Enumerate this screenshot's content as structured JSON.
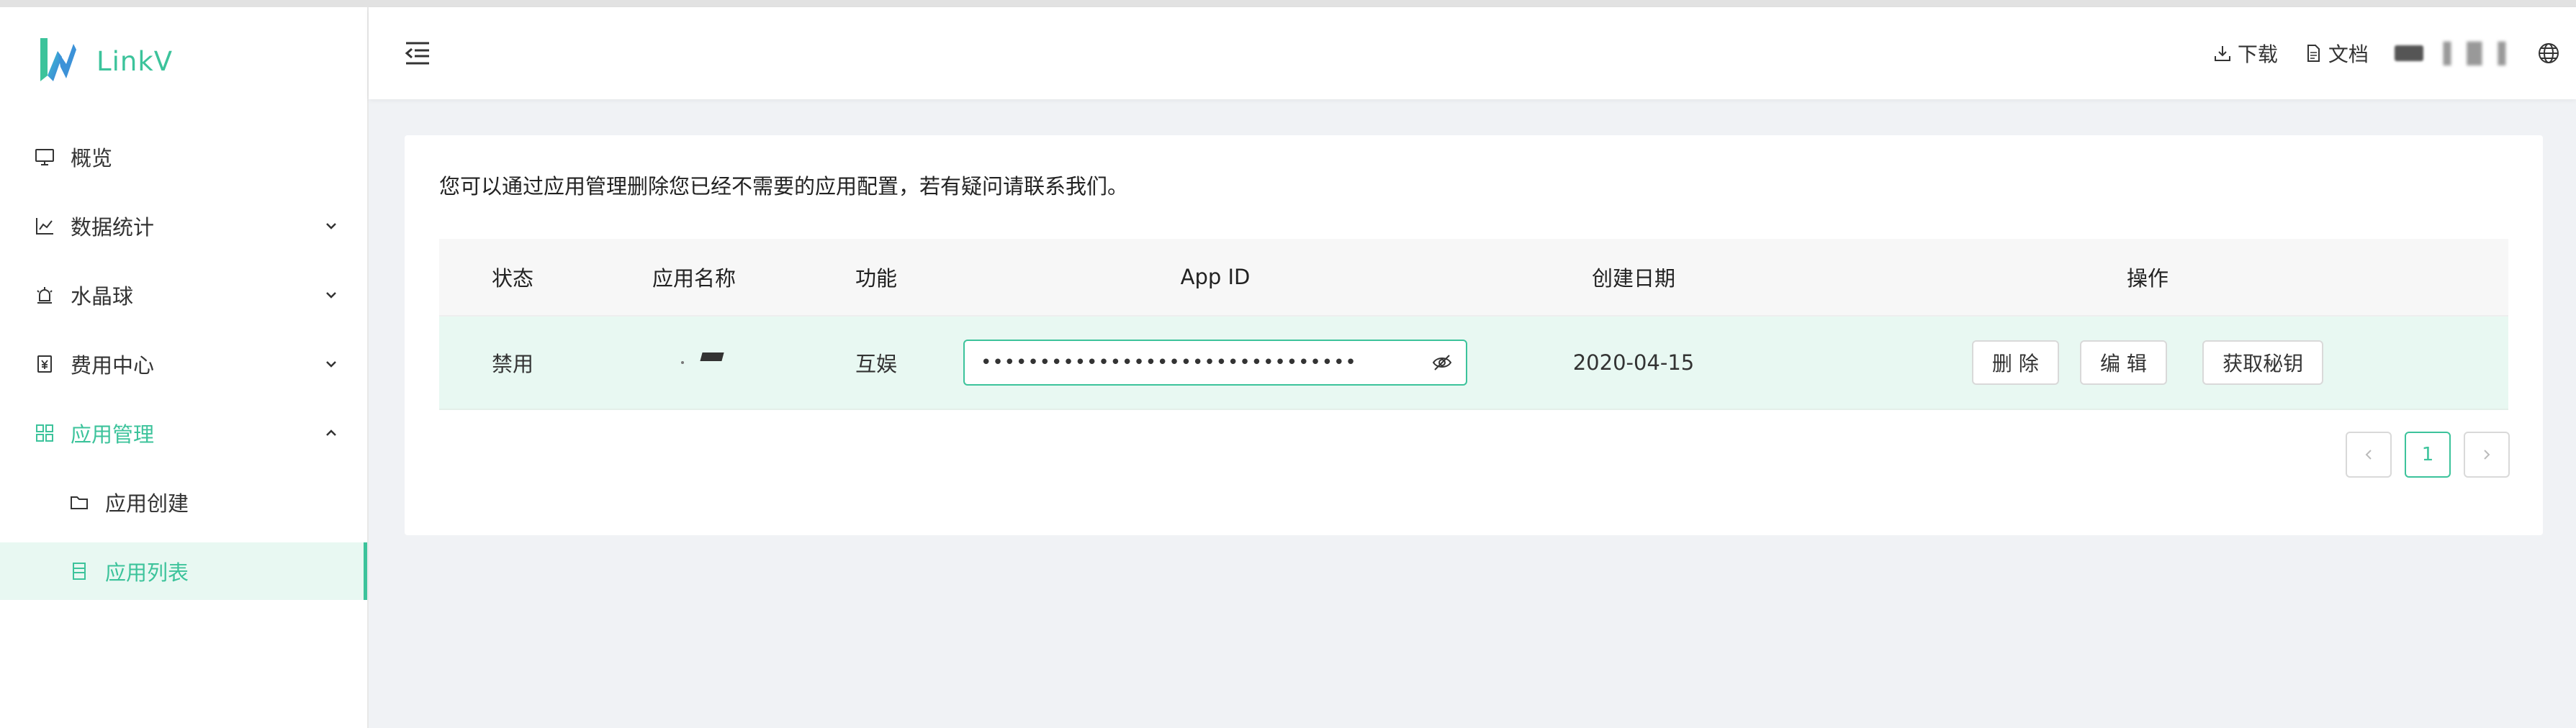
{
  "brand": {
    "name": "LinkV",
    "accent": "#3cc39b"
  },
  "sidebar": {
    "items": [
      {
        "label": "概览",
        "icon": "monitor-icon"
      },
      {
        "label": "数据统计",
        "icon": "line-chart-icon",
        "expand": "chevron-down-icon"
      },
      {
        "label": "水晶球",
        "icon": "alarm-icon",
        "expand": "chevron-down-icon"
      },
      {
        "label": "费用中心",
        "icon": "yen-doc-icon",
        "expand": "chevron-down-icon"
      },
      {
        "label": "应用管理",
        "icon": "grid-icon",
        "expand": "chevron-up-icon"
      },
      {
        "label": "应用创建",
        "icon": "folder-icon"
      },
      {
        "label": "应用列表",
        "icon": "list-icon"
      }
    ]
  },
  "header": {
    "download_label": "下载",
    "docs_label": "文档"
  },
  "main": {
    "notice": "您可以通过应用管理删除您已经不需要的应用配置，若有疑问请联系我们。",
    "columns": [
      "状态",
      "应用名称",
      "功能",
      "App ID",
      "创建日期",
      "操作"
    ],
    "rows": [
      {
        "status": "禁用",
        "function": "互娱",
        "app_id_masked": "••••••••••••••••••••••••••••••••",
        "created": "2020-04-15",
        "actions": [
          "删 除",
          "编 辑",
          "获取秘钥"
        ]
      }
    ],
    "pagination": {
      "current": "1"
    }
  }
}
